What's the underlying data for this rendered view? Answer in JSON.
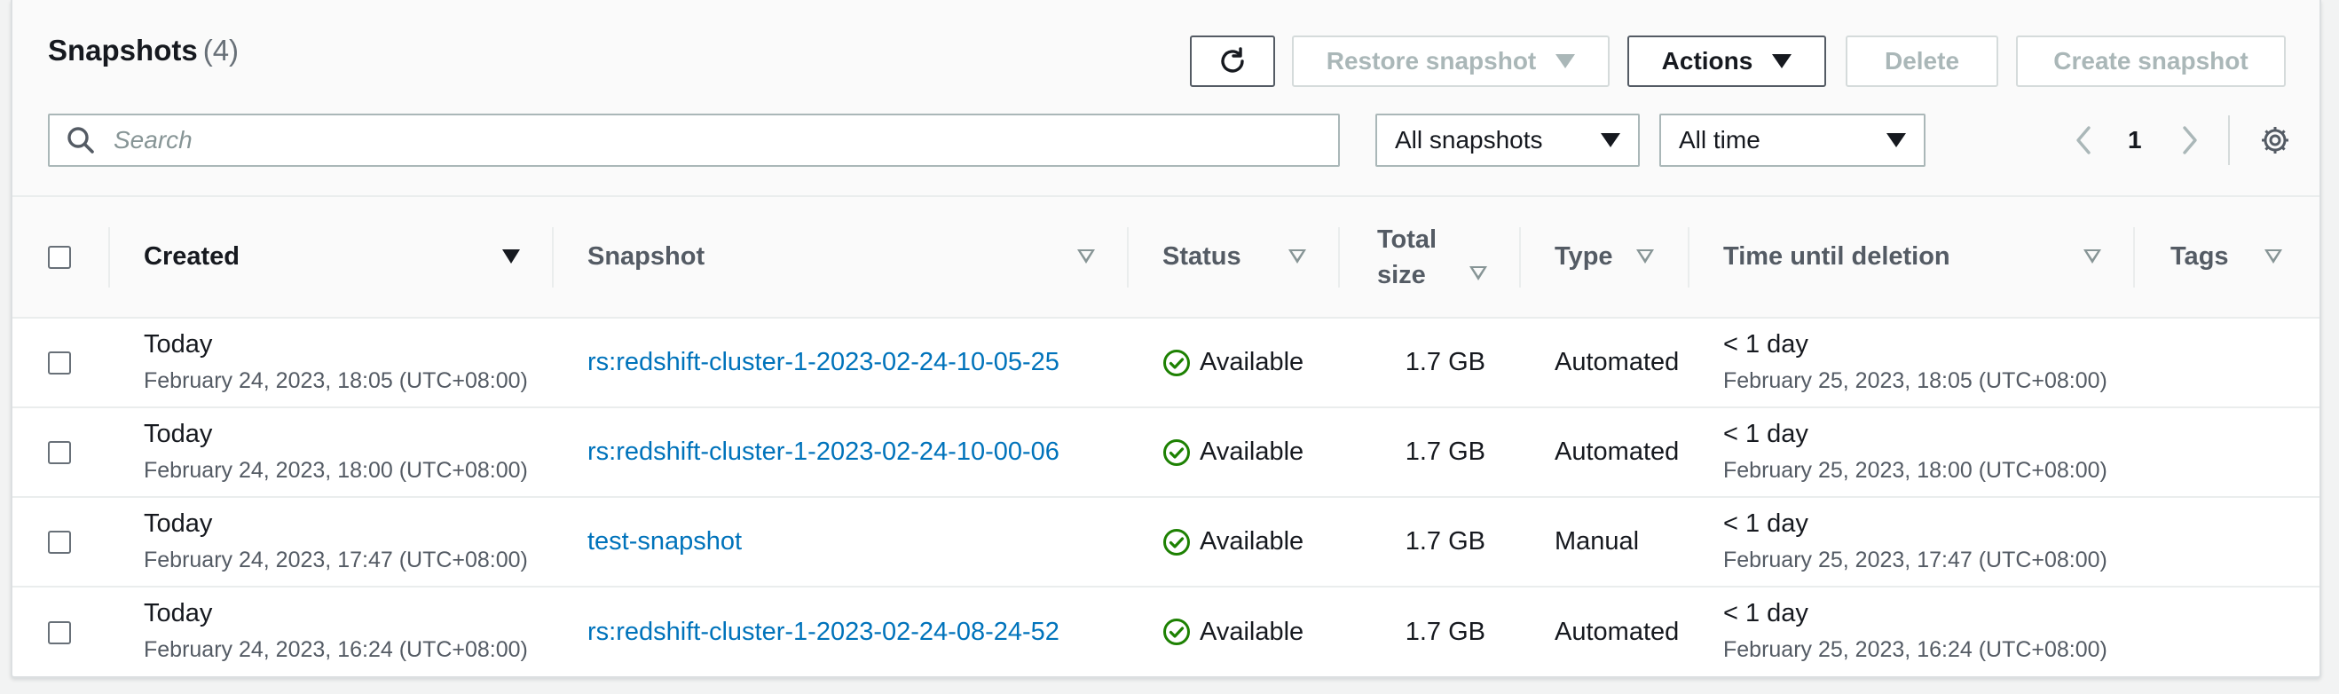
{
  "header": {
    "title": "Snapshots",
    "count": "(4)"
  },
  "toolbar": {
    "restore_label": "Restore snapshot",
    "actions_label": "Actions",
    "delete_label": "Delete",
    "create_label": "Create snapshot"
  },
  "filters": {
    "search_placeholder": "Search",
    "snapshot_filter": "All snapshots",
    "time_filter": "All time"
  },
  "pagination": {
    "current_page": "1"
  },
  "table": {
    "columns": {
      "created": "Created",
      "snapshot": "Snapshot",
      "status": "Status",
      "size_line1": "Total",
      "size_line2": "size",
      "type": "Type",
      "deletion": "Time until deletion",
      "tags": "Tags"
    },
    "rows": [
      {
        "created_main": "Today",
        "created_sub": "February 24, 2023, 18:05 (UTC+08:00)",
        "snapshot": "rs:redshift-cluster-1-2023-02-24-10-05-25",
        "status": "Available",
        "size": "1.7 GB",
        "type": "Automated",
        "deletion_main": "< 1 day",
        "deletion_sub": "February 25, 2023, 18:05 (UTC+08:00)"
      },
      {
        "created_main": "Today",
        "created_sub": "February 24, 2023, 18:00 (UTC+08:00)",
        "snapshot": "rs:redshift-cluster-1-2023-02-24-10-00-06",
        "status": "Available",
        "size": "1.7 GB",
        "type": "Automated",
        "deletion_main": "< 1 day",
        "deletion_sub": "February 25, 2023, 18:00 (UTC+08:00)"
      },
      {
        "created_main": "Today",
        "created_sub": "February 24, 2023, 17:47 (UTC+08:00)",
        "snapshot": "test-snapshot",
        "status": "Available",
        "size": "1.7 GB",
        "type": "Manual",
        "deletion_main": "< 1 day",
        "deletion_sub": "February 25, 2023, 17:47 (UTC+08:00)"
      },
      {
        "created_main": "Today",
        "created_sub": "February 24, 2023, 16:24 (UTC+08:00)",
        "snapshot": "rs:redshift-cluster-1-2023-02-24-08-24-52",
        "status": "Available",
        "size": "1.7 GB",
        "type": "Automated",
        "deletion_main": "< 1 day",
        "deletion_sub": "February 25, 2023, 16:24 (UTC+08:00)"
      }
    ]
  },
  "colors": {
    "link": "#0073bb",
    "success": "#1d8102",
    "disabled": "#aab7b8"
  },
  "icons": [
    "refresh-icon",
    "search-icon",
    "chevron-left-icon",
    "chevron-right-icon",
    "gear-icon",
    "check-circle-icon"
  ]
}
